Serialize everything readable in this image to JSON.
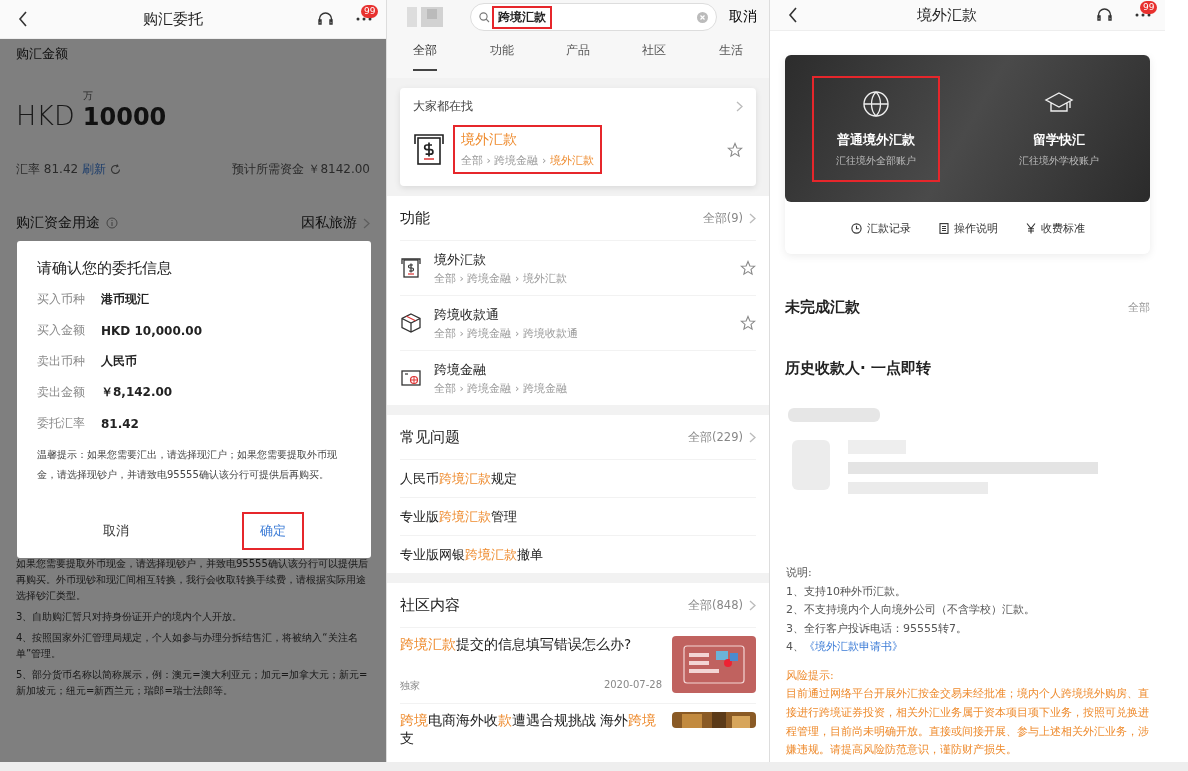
{
  "purchase_screen": {
    "header": {
      "title": "购汇委托",
      "badge": "99"
    },
    "amount_label": "购汇金额",
    "unit_hint": "万",
    "currency": "HKD",
    "amount": "10000",
    "rate_label": "汇率 81.42",
    "refresh_link": "刷新",
    "estimate_label": "预计所需资金",
    "estimate_value": "￥8142.00",
    "purpose_label": "购汇资金用途",
    "purpose_value": "因私旅游",
    "notes": [
      "如果您需要提取外币现金，请选择现钞户，并致电95555确认该分行可以提供后再购买。外币现钞和现汇间相互转换，我行会收取转换手续费，请根据实际用途选择钞汇类型。",
      "3、自助购汇暂只对持身份证开户的境内个人开放。",
      "4、按照国家外汇管理局规定，个人如参与办理分拆结售汇，将被纳入“关注名单”管理。",
      "5、部分货币名称以简称展示，例：澳元=澳大利亚元；加元=加拿大元；新元=新加坡元；纽元=新西兰元；瑞郎=瑞士法郎等。"
    ],
    "dialog": {
      "title": "请确认您的委托信息",
      "rows": [
        {
          "label": "买入币种",
          "value": "港币现汇"
        },
        {
          "label": "买入金额",
          "value": "HKD 10,000.00"
        },
        {
          "label": "卖出币种",
          "value": "人民币"
        },
        {
          "label": "卖出金额",
          "value": "￥8,142.00"
        },
        {
          "label": "委托汇率",
          "value": "81.42"
        }
      ],
      "tip": "温馨提示：如果您需要汇出，请选择现汇户；如果您需要提取外币现金，请选择现钞户，并请致电95555确认该分行可提供后再购买。",
      "buttons": [
        {
          "label": "取消",
          "primary": false,
          "highlighted": false
        },
        {
          "label": "确定",
          "primary": true,
          "highlighted": true
        }
      ]
    }
  },
  "search_screen": {
    "search": {
      "value": "跨境汇款",
      "highlighted": true
    },
    "cancel": "取消",
    "tabs": [
      {
        "label": "全部",
        "selected": true
      },
      {
        "label": "功能",
        "selected": false
      },
      {
        "label": "产品",
        "selected": false
      },
      {
        "label": "社区",
        "selected": false
      },
      {
        "label": "生活",
        "selected": false
      }
    ],
    "hot": {
      "title": "大家都在找",
      "item": {
        "title": "境外汇款",
        "highlighted": true,
        "path": [
          {
            "text": "全部 › 跨境金融 › ",
            "highlight": false
          },
          {
            "text": "境外汇款",
            "highlight": true
          }
        ]
      }
    },
    "functions": {
      "title": "功能",
      "more": "全部(9)",
      "items": [
        {
          "kind": "cash",
          "title": "境外汇款",
          "path": "全部 › 跨境金融 › 境外汇款",
          "favorite_button": true
        },
        {
          "kind": "box",
          "title": "跨境收款通",
          "path": "全部 › 跨境金融 › 跨境收款通",
          "favorite_button": true
        },
        {
          "kind": "globe-cash",
          "title": "跨境金融",
          "path": "全部 › 跨境金融 › 跨境金融",
          "favorite_button": false
        }
      ]
    },
    "faq": {
      "title": "常见问题",
      "more": "全部(229)",
      "items": [
        [
          {
            "text": "人民币",
            "highlight": false
          },
          {
            "text": "跨境汇款",
            "highlight": true
          },
          {
            "text": "规定",
            "highlight": false
          }
        ],
        [
          {
            "text": "专业版",
            "highlight": false
          },
          {
            "text": "跨境汇款",
            "highlight": true
          },
          {
            "text": "管理",
            "highlight": false
          }
        ],
        [
          {
            "text": "专业版网银",
            "highlight": false
          },
          {
            "text": "跨境汇款",
            "highlight": true
          },
          {
            "text": "撤单",
            "highlight": false
          }
        ]
      ]
    },
    "community": {
      "title": "社区内容",
      "more": "全部(848)",
      "posts": [
        {
          "title": [
            {
              "text": "跨境汇款",
              "highlight": true
            },
            {
              "text": "提交的信息填写错误怎么办?",
              "highlight": false
            }
          ],
          "source": "独家",
          "date": "2020-07-28"
        },
        {
          "title": [
            {
              "text": "跨境",
              "highlight": true
            },
            {
              "text": "电商海外收",
              "highlight": false
            },
            {
              "text": "款",
              "highlight": true
            },
            {
              "text": "遭遇合规挑战 海外",
              "highlight": false
            },
            {
              "text": "跨境",
              "highlight": true
            },
            {
              "text": "支",
              "highlight": false
            }
          ]
        }
      ]
    }
  },
  "remittance_screen": {
    "header": {
      "title": "境外汇款",
      "badge": "99"
    },
    "options": [
      {
        "kind": "globe",
        "title": "普通境外汇款",
        "subtitle": "汇往境外全部账户",
        "highlighted": true
      },
      {
        "kind": "cap",
        "title": "留学快汇",
        "subtitle": "汇往境外学校账户",
        "highlighted": false
      }
    ],
    "links": [
      {
        "kind": "clock",
        "label": "汇款记录"
      },
      {
        "kind": "document",
        "label": "操作说明"
      },
      {
        "kind": "yen",
        "label": "收费标准"
      }
    ],
    "pending": {
      "title": "未完成汇款",
      "more": "全部"
    },
    "history": {
      "title": "历史收款人· 一点即转"
    },
    "notes": {
      "title": "说明:",
      "items": [
        {
          "kind": "text",
          "number": "1、",
          "text": "支持10种外币汇款。"
        },
        {
          "kind": "text",
          "number": "2、",
          "text": "不支持境内个人向境外公司（不含学校）汇款。"
        },
        {
          "kind": "text",
          "number": "3、",
          "text": "全行客户投诉电话：95555转7。"
        },
        {
          "kind": "link",
          "number": "4、",
          "text": "《境外汇款申请书》"
        }
      ]
    },
    "risk": {
      "title": "风险提示:",
      "text": "目前通过网络平台开展外汇按金交易未经批准；境内个人跨境境外购房、直接进行跨境证券投资，相关外汇业务属于资本项目项下业务，按照可兑换进程管理，目前尚未明确开放。直接或间接开展、参与上述相关外汇业务，涉嫌违规。请提高风险防范意识，谨防财产损失。"
    }
  }
}
